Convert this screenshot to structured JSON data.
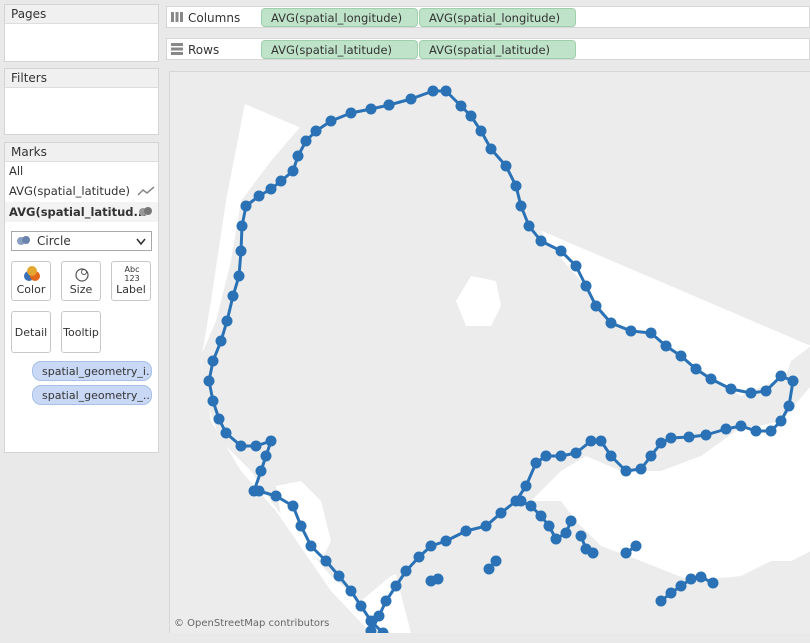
{
  "panels": {
    "pages_title": "Pages",
    "filters_title": "Filters",
    "marks_title": "Marks"
  },
  "shelves": {
    "columns_label": "Columns",
    "columns_pills": [
      "AVG(spatial_longitude)",
      "AVG(spatial_longitude)"
    ],
    "rows_label": "Rows",
    "rows_pills": [
      "AVG(spatial_latitude)",
      "AVG(spatial_latitude)"
    ]
  },
  "marks": {
    "all_label": "All",
    "layer1_label": "AVG(spatial_latitude)",
    "layer2_label": "AVG(spatial_latitud...",
    "mark_type": "Circle",
    "buttons": {
      "color": "Color",
      "size": "Size",
      "label": "Label",
      "label_icon_text": "Abc 123",
      "detail": "Detail",
      "tooltip": "Tooltip"
    },
    "fields": [
      "spatial_geometry_i..",
      "spatial_geometry_.."
    ]
  },
  "map": {
    "attribution": "© OpenStreetMap contributors",
    "mark_color": "#2a72b5",
    "land_color": "#ececec",
    "water_color": "#ffffff"
  },
  "colors": {
    "pill_green": "#bfe3c9",
    "pill_blue": "#c9d9f5"
  }
}
